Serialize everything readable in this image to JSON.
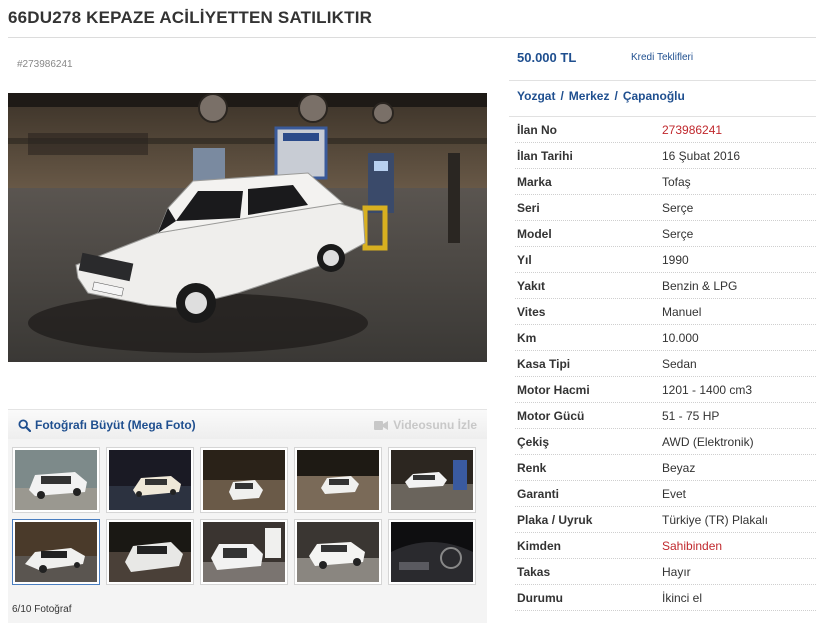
{
  "listing": {
    "title": "66DU278 KEPAZE ACİLİYETTEN SATILIKTIR",
    "id_label": "#273986241"
  },
  "gallery": {
    "mega_photo_label": "Fotoğrafı Büyüt (Mega Foto)",
    "video_label": "Videosunu İzle",
    "photo_count": "6/10 Fotoğraf",
    "selected_index": 6,
    "total_photos": 10
  },
  "pricing": {
    "price": "50.000 TL",
    "credit_link": "Kredi Teklifleri"
  },
  "location": {
    "city": "Yozgat",
    "district": "Merkez",
    "neighborhood": "Çapanoğlu",
    "separator": "/"
  },
  "details": [
    {
      "label": "İlan No",
      "value": "273986241",
      "highlight": true
    },
    {
      "label": "İlan Tarihi",
      "value": "16 Şubat 2016"
    },
    {
      "label": "Marka",
      "value": "Tofaş"
    },
    {
      "label": "Seri",
      "value": "Serçe"
    },
    {
      "label": "Model",
      "value": "Serçe"
    },
    {
      "label": "Yıl",
      "value": "1990"
    },
    {
      "label": "Yakıt",
      "value": "Benzin & LPG"
    },
    {
      "label": "Vites",
      "value": "Manuel"
    },
    {
      "label": "Km",
      "value": "10.000"
    },
    {
      "label": "Kasa Tipi",
      "value": "Sedan"
    },
    {
      "label": "Motor Hacmi",
      "value": "1201 - 1400 cm3"
    },
    {
      "label": "Motor Gücü",
      "value": "51 - 75 HP"
    },
    {
      "label": "Çekiş",
      "value": "AWD (Elektronik)"
    },
    {
      "label": "Renk",
      "value": "Beyaz"
    },
    {
      "label": "Garanti",
      "value": "Evet"
    },
    {
      "label": "Plaka / Uyruk",
      "value": "Türkiye (TR) Plakalı"
    },
    {
      "label": "Kimden",
      "value": "Sahibinden",
      "highlight": true
    },
    {
      "label": "Takas",
      "value": "Hayır"
    },
    {
      "label": "Durumu",
      "value": "İkinci el"
    }
  ],
  "colors": {
    "link_blue": "#1f4f8f",
    "highlight_red": "#c0282d",
    "selected_thumb_border": "#4a7ec0"
  },
  "icons": {
    "mega_photo": "magnifier-icon",
    "video": "video-camera-icon"
  }
}
